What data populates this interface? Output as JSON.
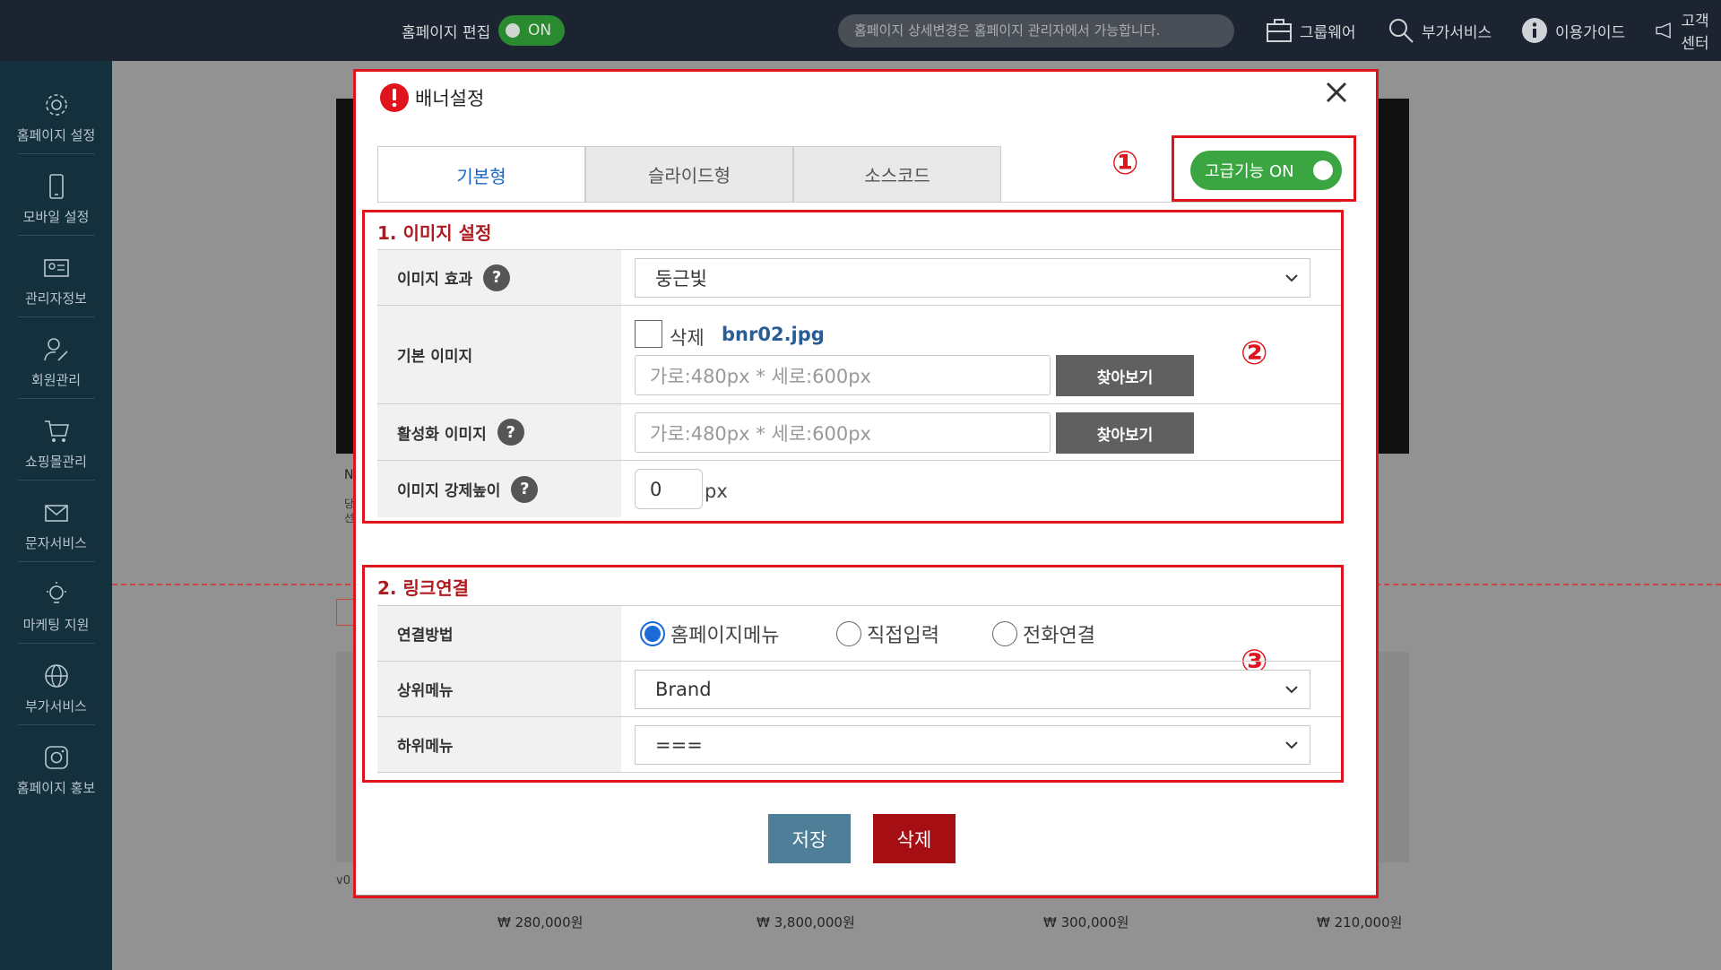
{
  "topbar": {
    "edit_label": "홈페이지 편집",
    "edit_toggle": "ON",
    "notice": "홈페이지 상세변경은 홈페이지 관리자에서 가능합니다.",
    "menu": [
      "그룹웨어",
      "부가서비스",
      "이용가이드",
      "고객센터"
    ]
  },
  "sidebar": {
    "items": [
      "홈페이지 설정",
      "모바일 설정",
      "관리자정보",
      "회원관리",
      "쇼핑몰관리",
      "문자서비스",
      "마케팅 지원",
      "부가서비스",
      "홈페이지 홍보"
    ]
  },
  "background": {
    "prices": [
      "₩ 280,000원",
      "₩ 3,800,000원",
      "₩ 300,000원",
      "₩ 210,000원"
    ],
    "partial_text": [
      "N",
      "당",
      "선",
      "v0"
    ]
  },
  "modal": {
    "title": "배너설정",
    "tabs": [
      "기본형",
      "슬라이드형",
      "소스코드"
    ],
    "advanced_toggle": "고급기능 ON",
    "markers": [
      "①",
      "②",
      "③"
    ],
    "section1": {
      "title": "1. 이미지 설정",
      "effect_label": "이미지 효과",
      "effect_value": "둥근빛",
      "base_image_label": "기본 이미지",
      "delete_label": "삭제",
      "file_name": "bnr02.jpg",
      "size_placeholder": "가로:480px * 세로:600px",
      "find_button": "찾아보기",
      "active_image_label": "활성화 이미지",
      "height_label": "이미지 강제높이",
      "height_value": "0",
      "height_unit": "px",
      "help": "?"
    },
    "section2": {
      "title": "2. 링크연결",
      "method_label": "연결방법",
      "methods": [
        "홈페이지메뉴",
        "직접입력",
        "전화연결"
      ],
      "selected_method": "홈페이지메뉴",
      "parent_label": "상위메뉴",
      "parent_value": "Brand",
      "child_label": "하위메뉴",
      "child_value": "==="
    },
    "save_button": "저장",
    "delete_button": "삭제"
  },
  "colors": {
    "topbar": "#1b2430",
    "sidebar": "#13303c",
    "accent_red": "#e0141c",
    "save": "#4e7e98",
    "delete": "#a50f14",
    "toggle_green": "#3aa541"
  }
}
